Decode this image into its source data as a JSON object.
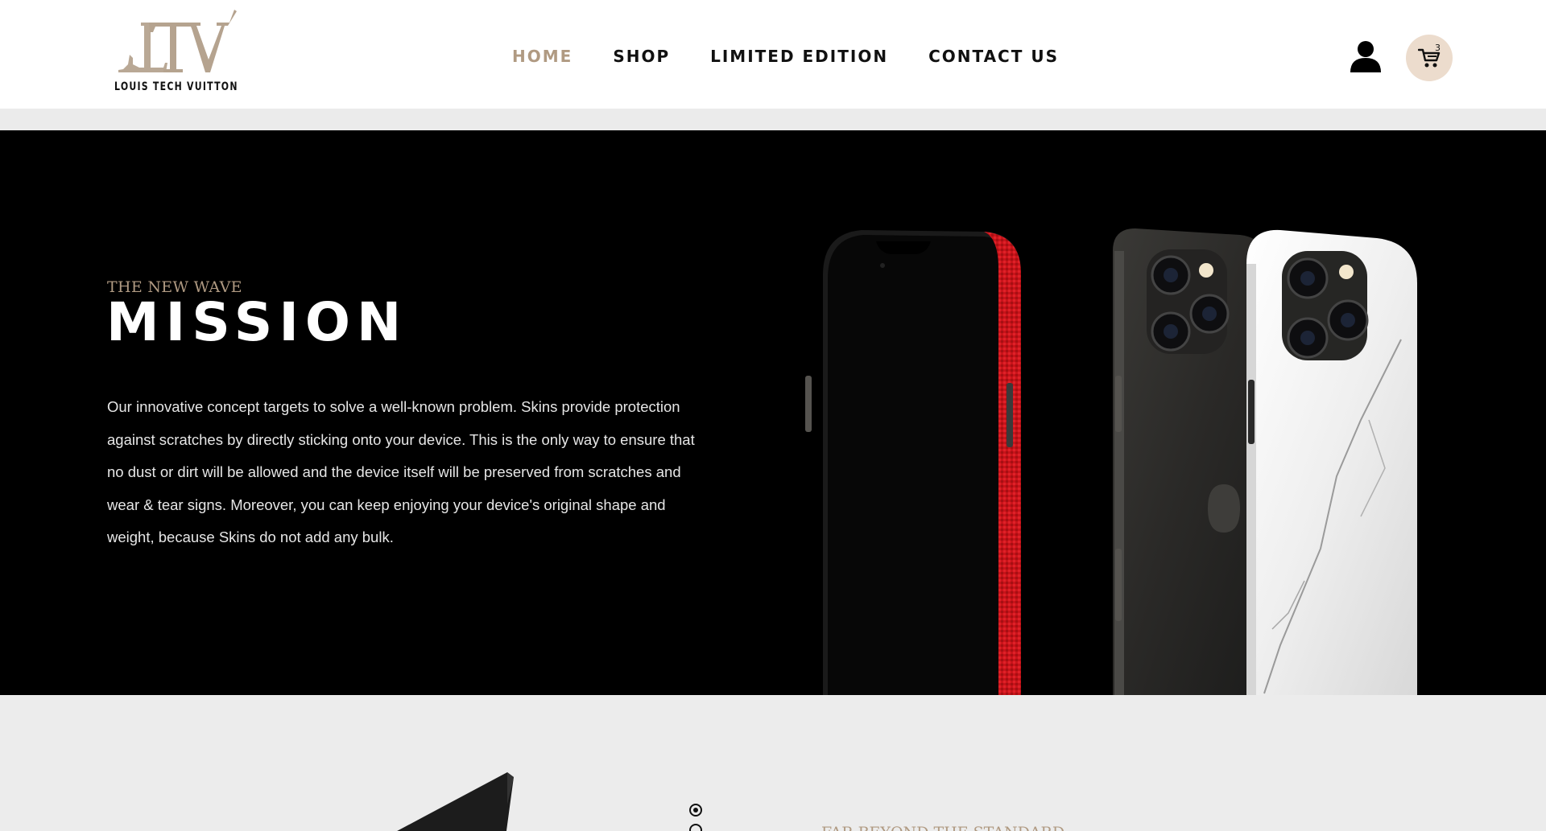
{
  "brand": {
    "monogram": "LTV",
    "name": "LOUIS TECH VUITTON",
    "accent_color": "#b09a82"
  },
  "nav": {
    "items": [
      {
        "label": "HOME",
        "active": true
      },
      {
        "label": "SHOP",
        "active": false
      },
      {
        "label": "LIMITED EDITION",
        "active": false
      },
      {
        "label": "CONTACT US",
        "active": false
      }
    ]
  },
  "header_actions": {
    "user_icon": "user-icon",
    "cart_icon": "cart-icon",
    "cart_count": "3",
    "cart_bg_color": "#ecdccd"
  },
  "hero": {
    "eyebrow": "THE NEW WAVE",
    "title": "MISSION",
    "body": "Our innovative concept targets to solve a well-known problem. Skins provide protection against scratches by directly sticking onto your device. This is the only way to ensure that no dust or dirt will be allowed and the device itself will be preserved from scratches and wear & tear signs. Moreover, you can keep enjoying your device's original shape and weight, because Skins do not add any bulk.",
    "background_color": "#000000"
  },
  "section2": {
    "eyebrow": "FAR BEYOND THE STANDARD",
    "slider_dots": [
      {
        "active": true
      },
      {
        "active": false
      }
    ]
  }
}
